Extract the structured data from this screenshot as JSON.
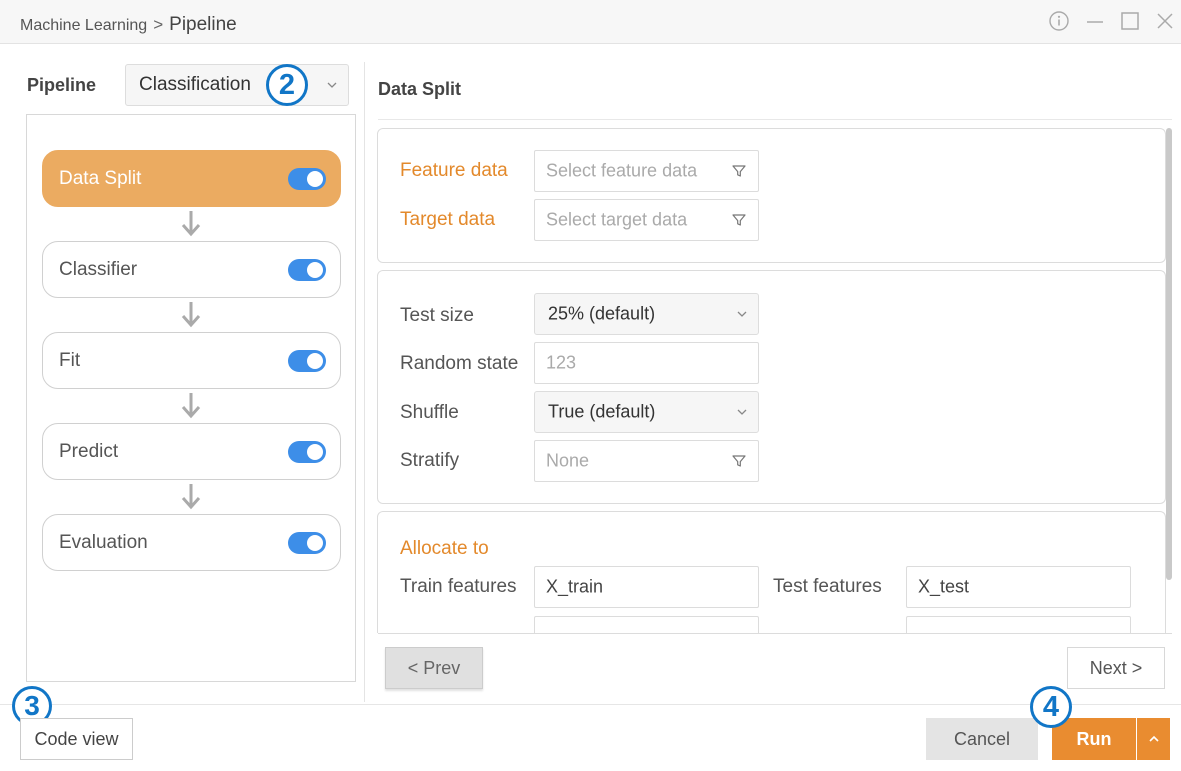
{
  "window": {
    "breadcrumb_root": "Machine Learning",
    "breadcrumb_separator": ">",
    "breadcrumb_current": "Pipeline",
    "controls": [
      "info-icon",
      "minimize-icon",
      "maximize-icon",
      "close-icon"
    ]
  },
  "pipeline": {
    "label": "Pipeline",
    "selected": "Classification",
    "steps": [
      {
        "label": "Data Split",
        "enabled": true,
        "active": true
      },
      {
        "label": "Classifier",
        "enabled": true,
        "active": false
      },
      {
        "label": "Fit",
        "enabled": true,
        "active": false
      },
      {
        "label": "Predict",
        "enabled": true,
        "active": false
      },
      {
        "label": "Evaluation",
        "enabled": true,
        "active": false
      }
    ]
  },
  "badges": {
    "b2": "2",
    "b3": "3",
    "b4": "4"
  },
  "data_split": {
    "title": "Data Split",
    "feature_label": "Feature data",
    "feature_placeholder": "Select feature data",
    "target_label": "Target data",
    "target_placeholder": "Select target data",
    "test_size_label": "Test size",
    "test_size_value": "25% (default)",
    "random_state_label": "Random state",
    "random_state_placeholder": "123",
    "shuffle_label": "Shuffle",
    "shuffle_value": "True (default)",
    "stratify_label": "Stratify",
    "stratify_placeholder": "None",
    "allocate_title": "Allocate to",
    "train_features_label": "Train features",
    "train_features_value": "X_train",
    "test_features_label": "Test features",
    "test_features_value": "X_test"
  },
  "nav": {
    "prev": "< Prev",
    "next": "Next >"
  },
  "footer": {
    "code_view": "Code view",
    "cancel": "Cancel",
    "run": "Run"
  },
  "colors": {
    "accent_orange": "#e98c30",
    "active_step": "#ebab61",
    "toggle_blue": "#3d8ee8",
    "badge_blue": "#1176c7"
  }
}
